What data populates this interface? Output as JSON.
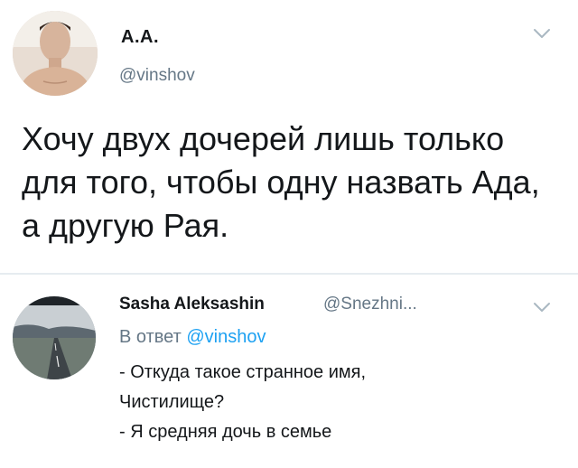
{
  "main_tweet": {
    "author_name": "А.А.",
    "author_handle": "@vinshov",
    "text": "Хочу двух дочерей лишь только для того, чтобы одну назвать Ада, а другую Рая.",
    "avatar_icon": "user-avatar-photo",
    "menu_icon": "chevron-down-icon"
  },
  "reply_tweet": {
    "author_name": "Sasha Aleksashin",
    "author_handle": "@Snezhni...",
    "reply_prefix": "В ответ",
    "reply_mention": "@vinshov",
    "lines": [
      "- Откуда такое странное имя,",
      "Чистилище?",
      "- Я средняя дочь в семье"
    ],
    "avatar_icon": "road-landscape-avatar",
    "menu_icon": "chevron-down-icon"
  },
  "colors": {
    "text": "#14171a",
    "secondary": "#657786",
    "link": "#1da1f2",
    "divider": "#e6ecf0"
  }
}
